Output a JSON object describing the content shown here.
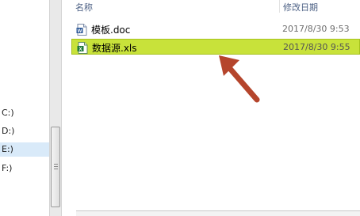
{
  "nav_pane": {
    "drives": [
      {
        "label": "C:)",
        "selected": false
      },
      {
        "label": "D:)",
        "selected": false
      },
      {
        "label": "E:)",
        "selected": true
      },
      {
        "label": "F:)",
        "selected": false
      }
    ]
  },
  "file_list": {
    "columns": {
      "name": "名称",
      "date_modified": "修改日期"
    },
    "files": [
      {
        "name": "模板.doc",
        "date": "2017/8/30 9:53",
        "type_icon": "word-doc-icon",
        "selected": false
      },
      {
        "name": "数据源.xls",
        "date": "2017/8/30 9:55",
        "type_icon": "excel-xls-icon",
        "selected": true
      }
    ]
  },
  "annotation": {
    "arrow_color": "#b5452c",
    "highlight_color": "#c8e23a"
  },
  "colors": {
    "word_blue": "#2b5797",
    "excel_green": "#1f7a3a",
    "header_text": "#4d6185"
  }
}
